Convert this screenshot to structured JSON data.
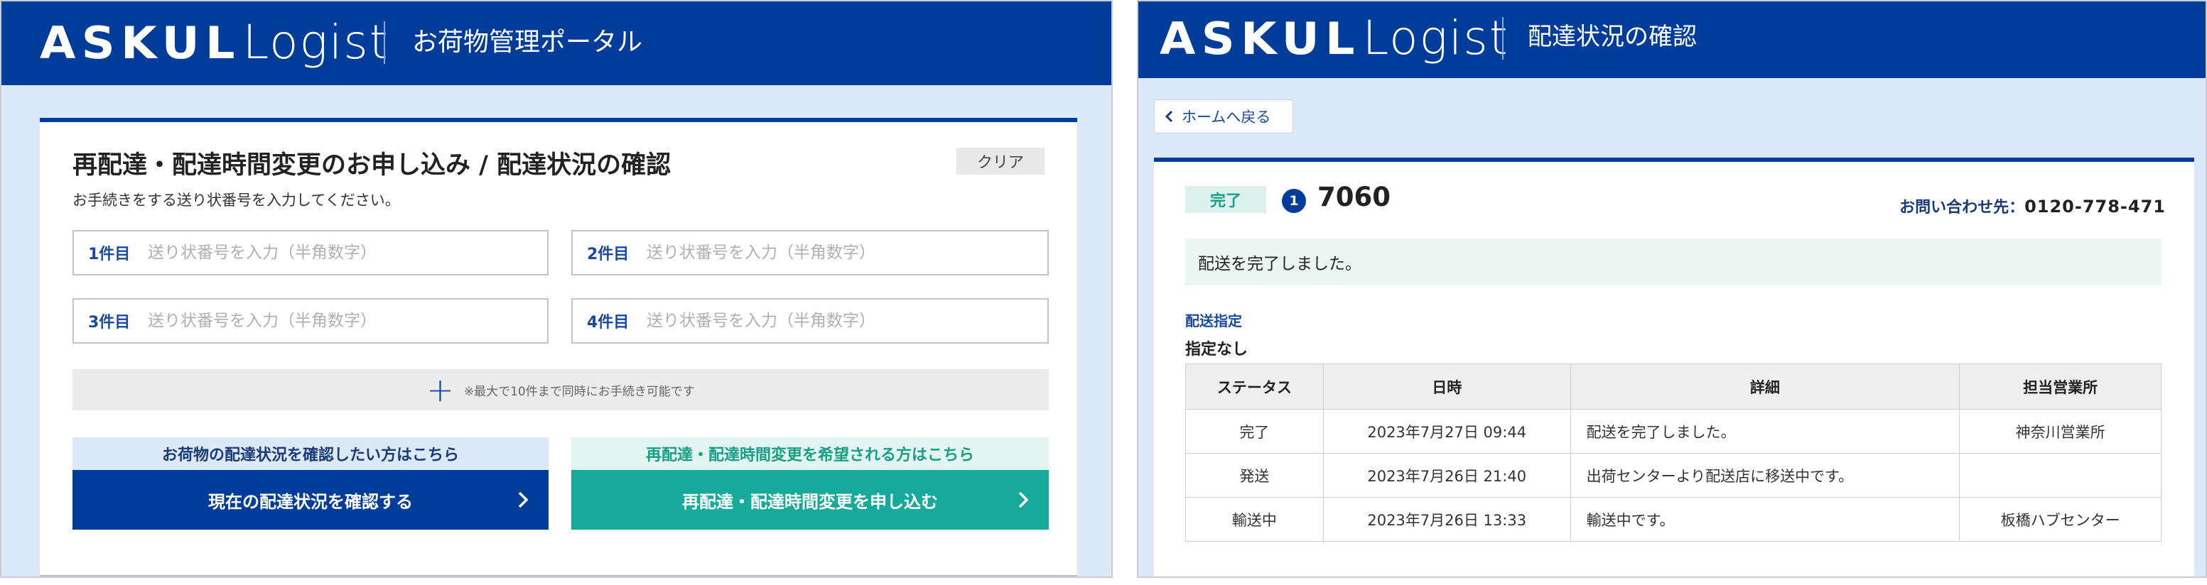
{
  "left": {
    "header": {
      "logo_askul": "ASKUL",
      "logo_logist": "Logist",
      "title": "お荷物管理ポータル"
    },
    "form": {
      "title": "再配達・配達時間変更のお申し込み / 配達状況の確認",
      "subtitle": "お手続きをする送り状番号を入力してください。",
      "clear_label": "クリア",
      "fields": [
        {
          "label": "1件目",
          "placeholder": "送り状番号を入力（半角数字）",
          "value": ""
        },
        {
          "label": "2件目",
          "placeholder": "送り状番号を入力（半角数字）",
          "value": ""
        },
        {
          "label": "3件目",
          "placeholder": "送り状番号を入力（半角数字）",
          "value": ""
        },
        {
          "label": "4件目",
          "placeholder": "送り状番号を入力（半角数字）",
          "value": ""
        }
      ],
      "add_note": "※最大で10件まで同時にお手続き可能です",
      "cta_status_head": "お荷物の配達状況を確認したい方はこちら",
      "cta_status_button": "現在の配達状況を確認する",
      "cta_redeliver_head": "再配達・配達時間変更を希望される方はこちら",
      "cta_redeliver_button": "再配達・配達時間変更を申し込む"
    },
    "colors": {
      "brand": "#003d9b",
      "accent_green": "#17a085",
      "page_bg": "#dbe9fb"
    }
  },
  "right": {
    "header": {
      "logo_askul": "ASKUL",
      "logo_logist": "Logist",
      "title": "配達状況の確認"
    },
    "back_label": "ホームへ戻る",
    "status_badge": "完了",
    "item_index": "1",
    "tracking_number": "7060",
    "contact_label": "お問い合わせ先：",
    "contact_number": "0120-778-471",
    "message": "配送を完了しました。",
    "delivery_spec_label": "配送指定",
    "delivery_spec_value": "指定なし",
    "table": {
      "headers": [
        "ステータス",
        "日時",
        "詳細",
        "担当営業所"
      ],
      "rows": [
        [
          "完了",
          "2023年7月27日 09:44",
          "配送を完了しました。",
          "神奈川営業所"
        ],
        [
          "発送",
          "2023年7月26日 21:40",
          "出荷センターより配送店に移送中です。",
          ""
        ],
        [
          "輸送中",
          "2023年7月26日 13:33",
          "輸送中です。",
          "板橋ハブセンター"
        ]
      ]
    }
  }
}
